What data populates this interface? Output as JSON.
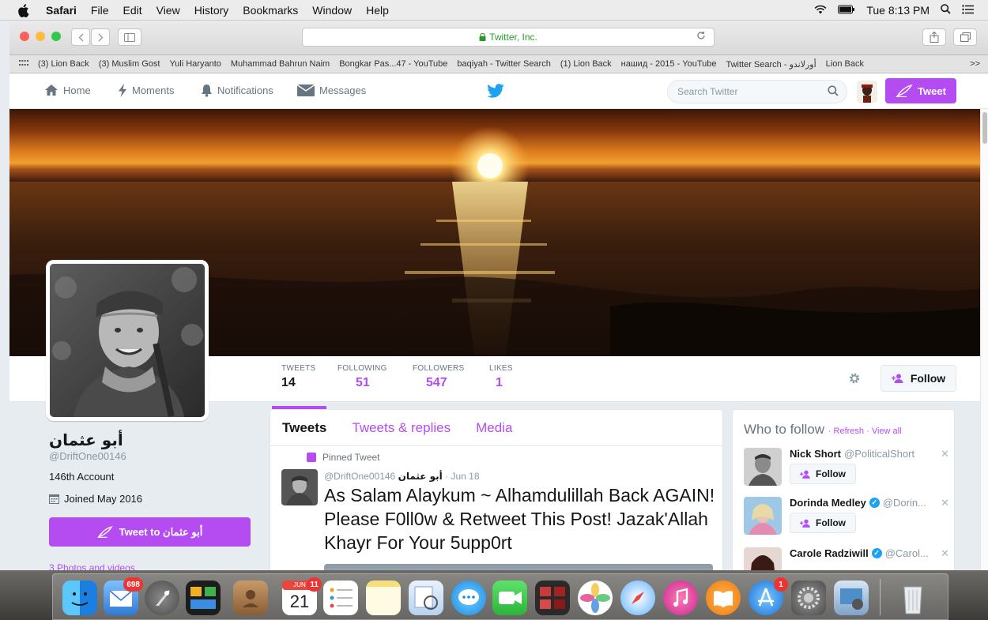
{
  "menubar": {
    "app": "Safari",
    "items": [
      "File",
      "Edit",
      "View",
      "History",
      "Bookmarks",
      "Window",
      "Help"
    ],
    "clock": "Tue 8:13 PM"
  },
  "browser": {
    "url_label": "Twitter, Inc.",
    "bookmarks": [
      "(3) Lion Back",
      "(3) Muslim Gost",
      "Yuli Haryanto",
      "Muhammad Bahrun Naim",
      "Bongkar Pas...47 - YouTube",
      "baqiyah - Twitter Search",
      "(1) Lion Back",
      "нашид - 2015 - YouTube",
      "Twitter Search - أورلاندو",
      "Lion Back"
    ],
    "bookmarks_more": ">>"
  },
  "twitter_nav": {
    "home": "Home",
    "moments": "Moments",
    "notifications": "Notifications",
    "messages": "Messages",
    "search_placeholder": "Search Twitter",
    "tweet_button": "Tweet"
  },
  "profile": {
    "name": "أبو عثمان",
    "handle": "@DriftOne00146",
    "bio": "146th Account",
    "joined": "Joined May 2016",
    "tweet_to_label": "Tweet to أبو عثمان",
    "photos_link": "3 Photos and videos",
    "follow_label": "Follow",
    "stats": [
      {
        "label": "TWEETS",
        "value": "14"
      },
      {
        "label": "FOLLOWING",
        "value": "51"
      },
      {
        "label": "FOLLOWERS",
        "value": "547"
      },
      {
        "label": "LIKES",
        "value": "1"
      }
    ]
  },
  "timeline": {
    "tabs": [
      "Tweets",
      "Tweets & replies",
      "Media"
    ],
    "pinned_label": "Pinned Tweet",
    "tweet": {
      "name": "أبو عثمان",
      "handle": "@DriftOne00146",
      "date": "· Jun 18",
      "text": "As Salam Alaykum ~ Alhamdulillah Back AGAIN! Please F0ll0w & Retweet This Post! Jazak'Allah Khayr For Your 5upp0rt"
    }
  },
  "who_to_follow": {
    "title": "Who to follow",
    "refresh": "Refresh",
    "view_all": "View all",
    "follow_label": "Follow",
    "users": [
      {
        "name": "Nick Short",
        "handle": "@PoliticalShort",
        "verified": false
      },
      {
        "name": "Dorinda Medley",
        "handle": "@Dorin...",
        "verified": true
      },
      {
        "name": "Carole Radziwill",
        "handle": "@Carol...",
        "verified": true
      }
    ]
  },
  "dock": {
    "mail_badge": "698",
    "calendar_month": "JUN",
    "calendar_day": "21",
    "calendar_badge": "11",
    "appstore_badge": "1"
  },
  "colors": {
    "accent": "#b44cf2",
    "link_blue": "#1da1f2",
    "bird_blue": "#1da1f2"
  }
}
